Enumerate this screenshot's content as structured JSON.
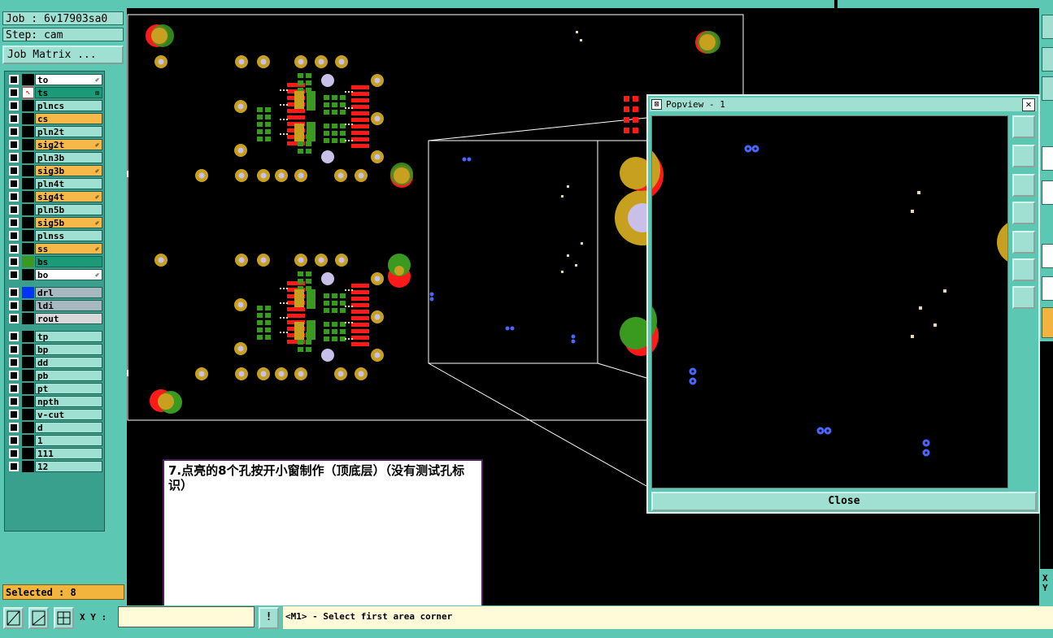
{
  "left_panel": {
    "job": "Job : 6v17903sa0",
    "step": "Step: cam",
    "job_matrix_button": "Job Matrix ...",
    "layers": [
      {
        "name": "to",
        "bg": "#ffffff",
        "color": "#000000",
        "marker": "✐"
      },
      {
        "name": "ts",
        "bg": "#1c9a78",
        "color": "#ff3030",
        "marker": "⊞"
      },
      {
        "name": "plncs",
        "bg": "#9fe0d2",
        "color": "#000000",
        "marker": ""
      },
      {
        "name": "cs",
        "bg": "#f7b84a",
        "color": "#000000",
        "marker": ""
      },
      {
        "name": "pln2t",
        "bg": "#9fe0d2",
        "color": "#000000",
        "marker": ""
      },
      {
        "name": "sig2t",
        "bg": "#f7b84a",
        "color": "#000000",
        "marker": "✐"
      },
      {
        "name": "pln3b",
        "bg": "#9fe0d2",
        "color": "#000000",
        "marker": ""
      },
      {
        "name": "sig3b",
        "bg": "#f7b84a",
        "color": "#000000",
        "marker": "✐"
      },
      {
        "name": "pln4t",
        "bg": "#9fe0d2",
        "color": "#000000",
        "marker": ""
      },
      {
        "name": "sig4t",
        "bg": "#f7b84a",
        "color": "#000000",
        "marker": "✐"
      },
      {
        "name": "pln5b",
        "bg": "#9fe0d2",
        "color": "#000000",
        "marker": ""
      },
      {
        "name": "sig5b",
        "bg": "#f7b84a",
        "color": "#000000",
        "marker": "✐"
      },
      {
        "name": "plnss",
        "bg": "#9fe0d2",
        "color": "#000000",
        "marker": ""
      },
      {
        "name": "ss",
        "bg": "#f7b84a",
        "color": "#000000",
        "marker": "✐"
      },
      {
        "name": "bs",
        "bg": "#1c9a78",
        "color": "#3a9a20",
        "marker": ""
      },
      {
        "name": "bo",
        "bg": "#ffffff",
        "color": "#000000",
        "marker": "✐"
      },
      {
        "name": "drl",
        "bg": "#a8b8c0",
        "color": "#0033ff",
        "marker": ""
      },
      {
        "name": "ldi",
        "bg": "#a8b8c0",
        "color": "#000000",
        "marker": ""
      },
      {
        "name": "rout",
        "bg": "#d8d8d8",
        "color": "#000000",
        "marker": ""
      },
      {
        "name": "tp",
        "bg": "#9fe0d2",
        "color": "#000000",
        "marker": ""
      },
      {
        "name": "bp",
        "bg": "#9fe0d2",
        "color": "#000000",
        "marker": ""
      },
      {
        "name": "dd",
        "bg": "#9fe0d2",
        "color": "#000000",
        "marker": ""
      },
      {
        "name": "pb",
        "bg": "#9fe0d2",
        "color": "#000000",
        "marker": ""
      },
      {
        "name": "pt",
        "bg": "#9fe0d2",
        "color": "#000000",
        "marker": ""
      },
      {
        "name": "npth",
        "bg": "#9fe0d2",
        "color": "#000000",
        "marker": ""
      },
      {
        "name": "v-cut",
        "bg": "#9fe0d2",
        "color": "#000000",
        "marker": ""
      },
      {
        "name": "d",
        "bg": "#9fe0d2",
        "color": "#000000",
        "marker": ""
      },
      {
        "name": "1",
        "bg": "#9fe0d2",
        "color": "#000000",
        "marker": ""
      },
      {
        "name": "111",
        "bg": "#9fe0d2",
        "color": "#000000",
        "marker": ""
      },
      {
        "name": "12",
        "bg": "#9fe0d2",
        "color": "#000000",
        "marker": ""
      }
    ],
    "selected": "Selected : 8"
  },
  "bottom_bar": {
    "xy_label": "X Y :",
    "xy_value": "",
    "warn_glyph": "!",
    "status": "<M1> - Select first area corner"
  },
  "note": {
    "text": "7.点亮的8个孔按开小窗制作（顶底层）（没有测试孔标识）"
  },
  "popview": {
    "title": "Popview - 1",
    "close_label": "Close",
    "close_glyph": "✕"
  },
  "right_strip": {
    "xy_label_x": "X",
    "xy_label_y": "Y"
  },
  "colors": {
    "panel": "#5cc7b2",
    "pad_gold": "#c8a020",
    "pad_red": "#ff1a1a",
    "pad_green": "#3a9a20",
    "drill_blue": "#4a66ff"
  }
}
